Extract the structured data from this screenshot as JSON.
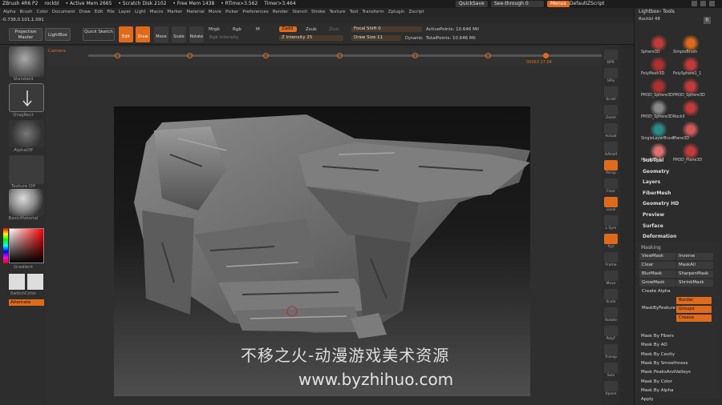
{
  "titlebar": {
    "app": "ZBrush 4R6 P2",
    "doc": "rockbl",
    "active_mem": "• Active Mem 2665",
    "scratch": "• Scratch Disk 2102",
    "free_mem": "• Free Mem 1438",
    "rtime": "• RTime>3.562",
    "timer": "Timer>3.464",
    "quicksave": "QuickSave",
    "seethrough": "See-through  0",
    "menus": "Menus",
    "script": "DefaultZScript"
  },
  "menubar": [
    "Alpha",
    "Brush",
    "Color",
    "Document",
    "Draw",
    "Edit",
    "File",
    "Layer",
    "Light",
    "Macro",
    "Marker",
    "Material",
    "Movie",
    "Picker",
    "Preferences",
    "Render",
    "Stencil",
    "Stroke",
    "Texture",
    "Tool",
    "Transform",
    "Zplugin",
    "Zscript"
  ],
  "status": "-0.738,0.101,1.091",
  "topshelf": {
    "projection_master": "Projection Master",
    "lightbox": "LightBox",
    "quick_sketch": "Quick Sketch",
    "edit": "Edit",
    "draw": "Draw",
    "move": "Move",
    "scale": "Scale",
    "rotate": "Rotate",
    "mrgb": "Mrgb",
    "rgb": "Rgb",
    "m": "M",
    "rgb_intensity": "Rgb Intensity",
    "zadd": "Zadd",
    "zsub": "Zsub",
    "zcut": "Zcut",
    "z_intensity": "Z Intensity 25",
    "focal_shift": "Focal Shift 0",
    "draw_size": "Draw Size 11",
    "dynamic": "Dynamic",
    "active_points": "ActivePoints: 10.646 Mil",
    "total_points": "TotalPoints: 10.646 Mil"
  },
  "leftshelf": {
    "standard": "Standard",
    "dragrect": "DragRect",
    "alpha_off": "AlphaOff",
    "texture_off": "Texture Off",
    "basic_material": "BasicMaterial",
    "gradient": "Gradient",
    "switch_color": "SwitchColor",
    "alternate": "Alternate"
  },
  "ruler": {
    "camera": "Camera",
    "readout": "00063  27.04"
  },
  "rightshelf": [
    "BPR",
    "SPix",
    "Scroll",
    "Zoom",
    "Actual",
    "AAHalf",
    "Persp",
    "Floor",
    "Local",
    "L.Sym",
    "Xyz",
    "Frame",
    "Move",
    "Scale",
    "Rotate",
    "PolyF",
    "Transp",
    "Solo",
    "Xpose"
  ],
  "palette": {
    "header": "Lightbox› Tools",
    "rock": "Rockbl 48",
    "r_btn": "R",
    "tools": [
      "Sphere3D",
      "SimpleBrush",
      "PolyMesh3D",
      "PolySphere1_1",
      "PM3D_Sphere3D",
      "PM3D_Sphere3D",
      "PM3D_Sphere3D",
      "Rock3",
      "SingleLayerBrush",
      "Plane3D",
      "Plane3D_1",
      "PM3D_Plane3D"
    ],
    "sections": [
      "SubTool",
      "Geometry",
      "Layers",
      "FiberMesh",
      "Geometry HD",
      "Preview",
      "Surface",
      "Deformation"
    ],
    "masking": "Masking",
    "viewmask": "ViewMask",
    "inverse": "Inverse",
    "clear": "Clear",
    "maskall": "MaskAll",
    "blurmask": "BlurMask",
    "sharpenmask": "SharpenMask",
    "growmask": "GrowMask",
    "shrinkmask": "ShrinkMask",
    "create_alpha": "Create Alpha",
    "mask_by_feature": "MaskByFeature",
    "border": "Border",
    "groups": "Groups",
    "crease": "Crease",
    "mask_rows": [
      "Mask By Fibers",
      "Mask By AO",
      "Mask By Cavity",
      "Mask By Smoothness",
      "Mask PeaksAndValleys",
      "Mask By Color",
      "Mask By Alpha",
      "Apply"
    ]
  },
  "watermark": {
    "line1": "不移之火-动漫游戏美术资源",
    "line2": "www.byzhihuo.com"
  }
}
